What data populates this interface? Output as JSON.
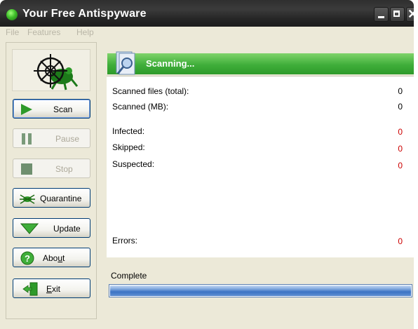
{
  "window": {
    "title": "Your Free Antispyware",
    "controls": {
      "minimize": "minimize-icon",
      "maximize": "maximize-icon",
      "close": "close-icon"
    }
  },
  "menu": {
    "items": [
      "File",
      "Features",
      "Help"
    ]
  },
  "sidebar": {
    "buttons": [
      {
        "label": "Scan",
        "icon": "play-icon",
        "enabled": true
      },
      {
        "label": "Pause",
        "icon": "pause-icon",
        "enabled": false
      },
      {
        "label": "Stop",
        "icon": "stop-icon",
        "enabled": false
      },
      {
        "label": "Quarantine",
        "icon": "bug-icon",
        "enabled": true
      },
      {
        "label": "Update",
        "icon": "download-arrow-icon",
        "enabled": true
      },
      {
        "label": "About",
        "icon": "help-icon",
        "enabled": true
      },
      {
        "label": "Exit",
        "icon": "exit-door-icon",
        "enabled": true
      }
    ]
  },
  "scan": {
    "status": "Scanning...",
    "stats": [
      {
        "label": "Scanned files (total):",
        "value": "0",
        "color": "#000000"
      },
      {
        "label": "Scanned (MB):",
        "value": "0",
        "color": "#000000"
      },
      {
        "label": "Infected:",
        "value": "0",
        "color": "#cc0000"
      },
      {
        "label": "Skipped:",
        "value": "0",
        "color": "#cc0000"
      },
      {
        "label": "Suspected:",
        "value": "0",
        "color": "#cc0000"
      },
      {
        "label": "Errors:",
        "value": "0",
        "color": "#cc0000"
      }
    ],
    "progress_label": "Complete",
    "progress_fraction": 1.0
  },
  "colors": {
    "header_green": "#3fae3a",
    "progress_blue": "#3b73c4",
    "titlebar": "#2f2f2f"
  }
}
